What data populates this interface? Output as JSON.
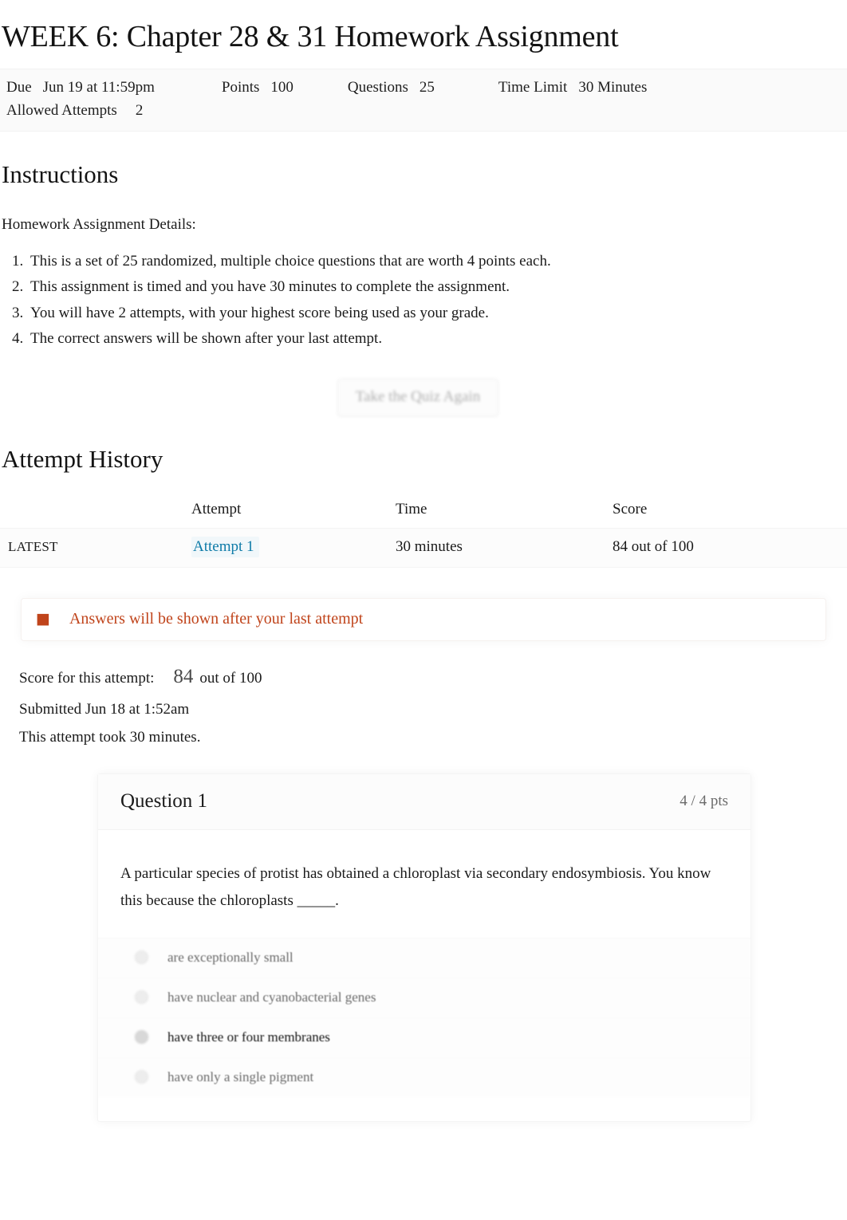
{
  "page": {
    "title": "WEEK 6: Chapter 28 & 31 Homework Assignment"
  },
  "quiz_meta": {
    "due_label": "Due",
    "due_value": "Jun 19 at 11:59pm",
    "points_label": "Points",
    "points_value": "100",
    "questions_label": "Questions",
    "questions_value": "25",
    "time_limit_label": "Time Limit",
    "time_limit_value": "30 Minutes",
    "allowed_attempts_label": "Allowed Attempts",
    "allowed_attempts_value": "2"
  },
  "instructions": {
    "heading": "Instructions",
    "lead": "Homework Assignment Details:",
    "items": [
      "This is a set of 25 randomized, multiple choice questions that are worth 4 points each.",
      "This assignment is timed and you have 30 minutes to complete the assignment.",
      "You will have 2 attempts, with your highest score being used as your grade.",
      "The correct answers will be shown after your last attempt."
    ]
  },
  "actions": {
    "take_again_label": "Take the Quiz Again"
  },
  "attempt_history": {
    "heading": "Attempt History",
    "columns": [
      "",
      "Attempt",
      "Time",
      "Score"
    ],
    "rows": [
      {
        "kept": "LATEST",
        "attempt": "Attempt 1",
        "time": "30 minutes",
        "score": "84 out of 100"
      }
    ]
  },
  "alert": {
    "icon": "warning-icon",
    "text": "Answers will be shown after your last attempt",
    "color": "#c0441b"
  },
  "attempt_summary": {
    "score_label": "Score for this attempt:",
    "score_value": "84",
    "score_suffix": "out of 100",
    "submitted": "Submitted Jun 18 at 1:52am",
    "duration": "This attempt took 30 minutes."
  },
  "question": {
    "name": "Question 1",
    "points": "4 / 4 pts",
    "text": "A particular species of protist has obtained a chloroplast via secondary endosymbiosis. You know this because the chloroplasts _____.",
    "answers": [
      {
        "text": "are exceptionally small",
        "selected": false
      },
      {
        "text": "have nuclear and cyanobacterial genes",
        "selected": false
      },
      {
        "text": "have three or four membranes",
        "selected": true
      },
      {
        "text": "have only a single pigment",
        "selected": false
      }
    ]
  },
  "colors": {
    "link": "#0e7ba8",
    "alert": "#c0441b",
    "text": "#1a1a1a"
  }
}
